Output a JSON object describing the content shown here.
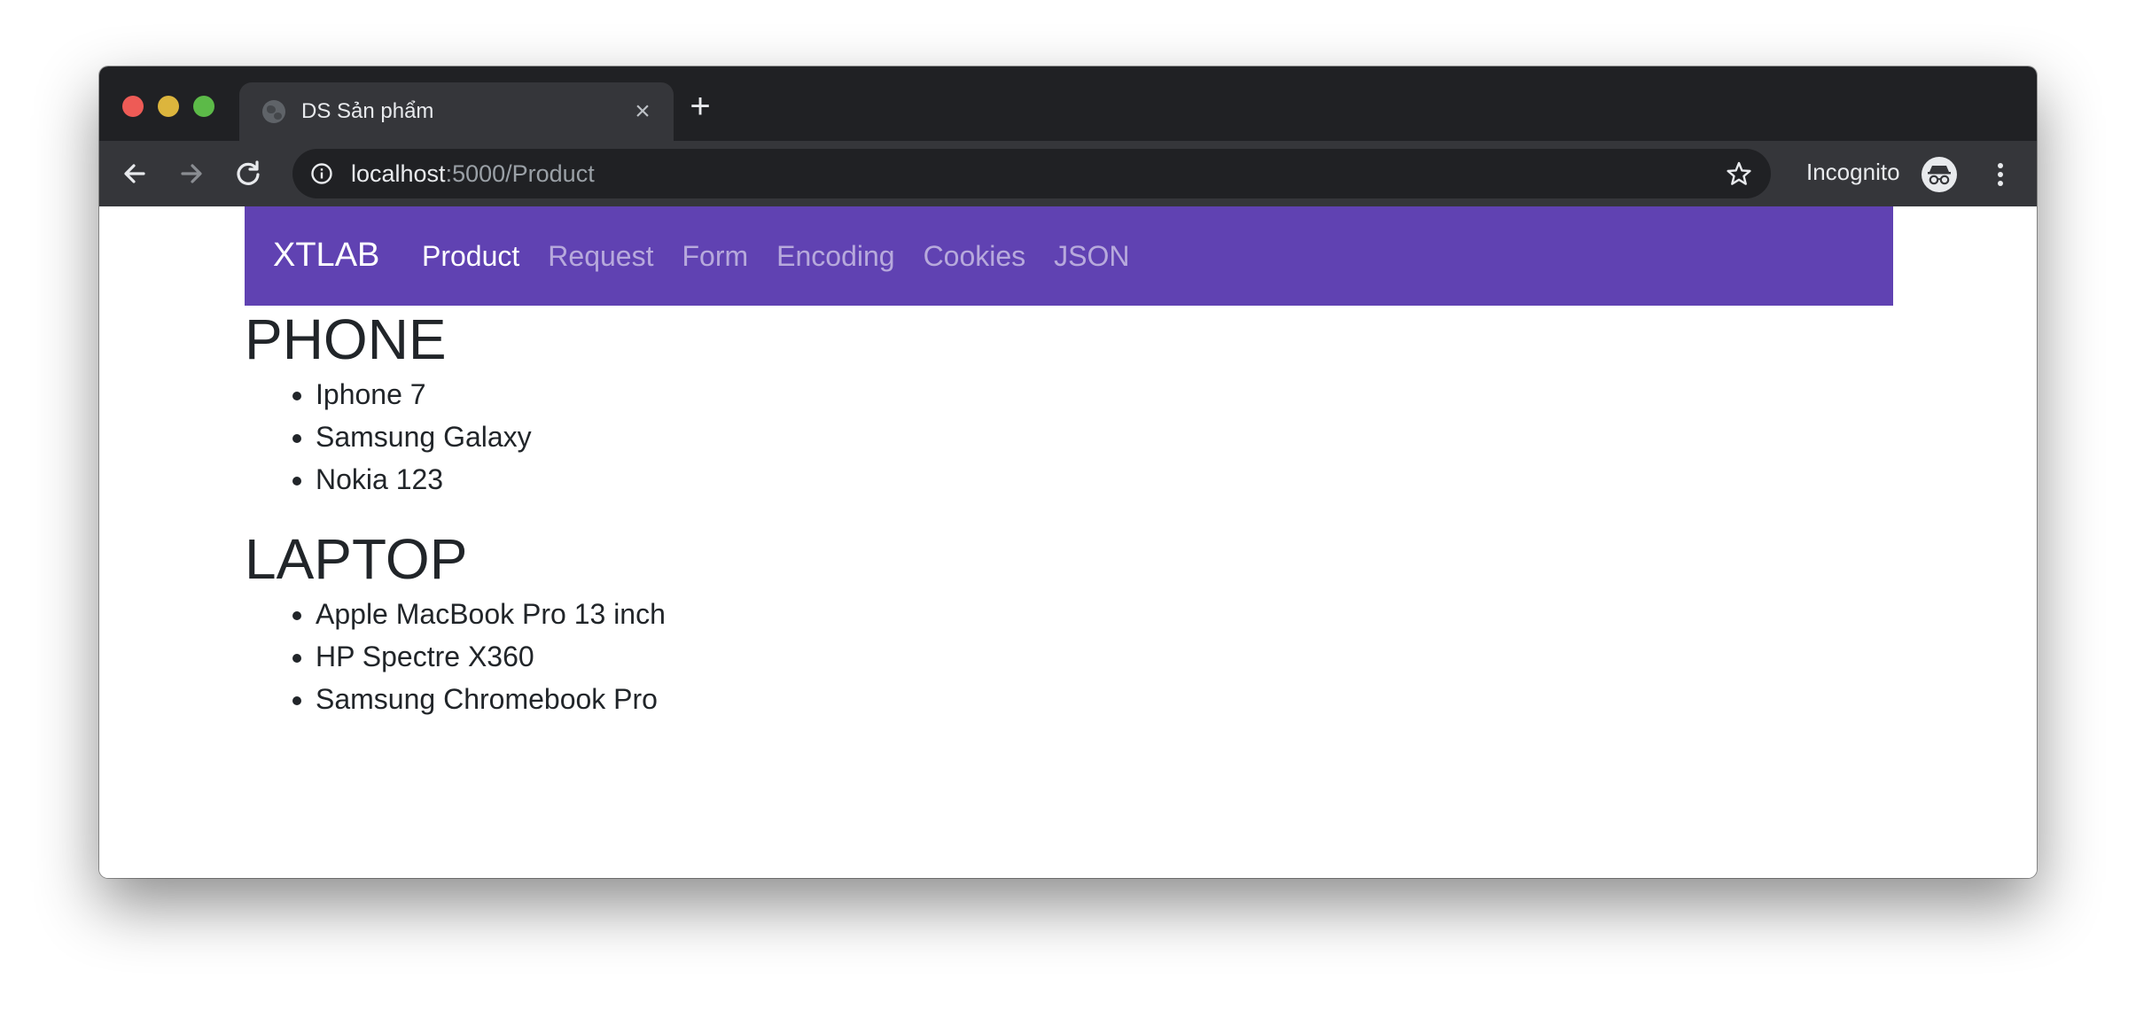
{
  "browser": {
    "tab_title": "DS Sản phẩm",
    "tab_close_symbol": "×",
    "new_tab_symbol": "+",
    "url_host": "localhost",
    "url_rest": ":5000/Product",
    "incognito_label": "Incognito",
    "icons": {
      "back": "arrow-left-icon",
      "forward": "arrow-right-icon",
      "reload": "reload-icon",
      "info": "info-icon",
      "bookmark": "star-icon",
      "incognito": "incognito-icon",
      "menu": "kebab-menu-icon"
    }
  },
  "navbar": {
    "brand": "XTLAB",
    "links": [
      "Product",
      "Request",
      "Form",
      "Encoding",
      "Cookies",
      "JSON"
    ],
    "active": "Product",
    "background": "#6042b2"
  },
  "sections": [
    {
      "heading": "PHONE",
      "items": [
        "Iphone 7",
        "Samsung Galaxy",
        "Nokia 123"
      ]
    },
    {
      "heading": "LAPTOP",
      "items": [
        "Apple MacBook Pro 13 inch",
        "HP Spectre X360",
        "Samsung Chromebook Pro"
      ]
    }
  ]
}
